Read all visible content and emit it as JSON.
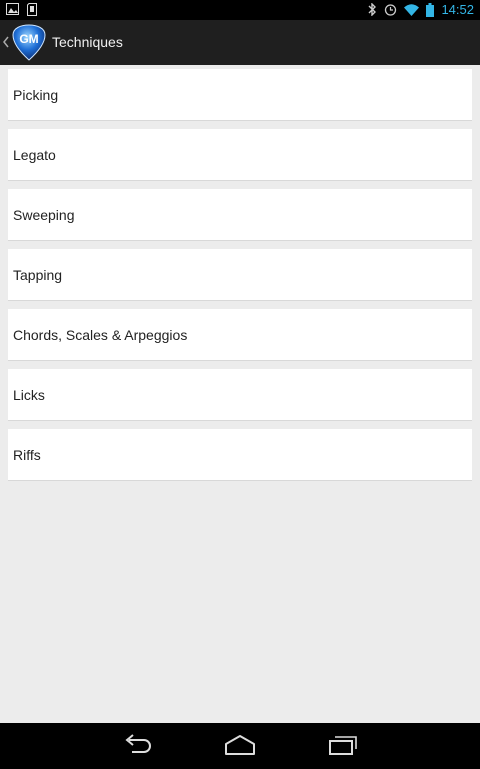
{
  "status_bar": {
    "time": "14:52",
    "icons": [
      "gallery-icon",
      "sd-card-icon",
      "bluetooth-icon",
      "alarm-icon",
      "wifi-icon",
      "battery-icon"
    ]
  },
  "action_bar": {
    "title": "Techniques",
    "logo_text": "GM"
  },
  "items": [
    {
      "label": "Picking"
    },
    {
      "label": "Legato"
    },
    {
      "label": "Sweeping"
    },
    {
      "label": "Tapping"
    },
    {
      "label": "Chords, Scales & Arpeggios"
    },
    {
      "label": "Licks"
    },
    {
      "label": "Riffs"
    }
  ],
  "nav_bar": {
    "icons": [
      "back-icon",
      "home-icon",
      "recent-apps-icon"
    ]
  },
  "colors": {
    "accent": "#33b5e5",
    "background": "#ececec",
    "action_bar": "#1f1f1f"
  }
}
